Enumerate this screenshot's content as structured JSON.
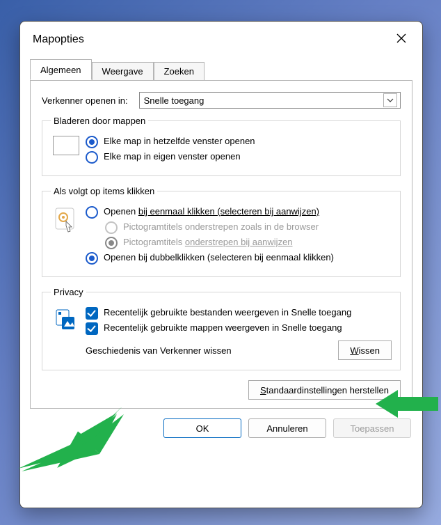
{
  "window": {
    "title": "Mapopties"
  },
  "tabs": {
    "general": "Algemeen",
    "view": "Weergave",
    "search": "Zoeken"
  },
  "openin": {
    "label": "Verkenner openen in:",
    "value": "Snelle toegang"
  },
  "browse": {
    "legend": "Bladeren door mappen",
    "opt_same": "Elke map in hetzelfde venster openen",
    "opt_own": "Elke map in eigen venster openen"
  },
  "click": {
    "legend": "Als volgt op items klikken",
    "opt_single_a": "Openen ",
    "opt_single_b": "bij eenmaal klikken (selecteren bij aanwijzen)",
    "sub_browser": "Pictogramtitels onderstrepen zoals in de browser",
    "sub_point_a": "Pictogramtitels ",
    "sub_point_b": "onderstrepen bij aanwijzen",
    "opt_double": "Openen bij dubbelklikken (selecteren bij eenmaal klikken)"
  },
  "privacy": {
    "legend": "Privacy",
    "chk_files": "Recentelijk gebruikte bestanden weergeven in Snelle toegang",
    "chk_folders": "Recentelijk gebruikte mappen weergeven in Snelle toegang",
    "history_label": "Geschiedenis van Verkenner wissen",
    "clear_btn_u": "W",
    "clear_btn_rest": "issen"
  },
  "restore": {
    "label_u": "S",
    "label_rest": "tandaardinstellingen herstellen"
  },
  "actions": {
    "ok": "OK",
    "cancel": "Annuleren",
    "apply": "Toepassen"
  }
}
